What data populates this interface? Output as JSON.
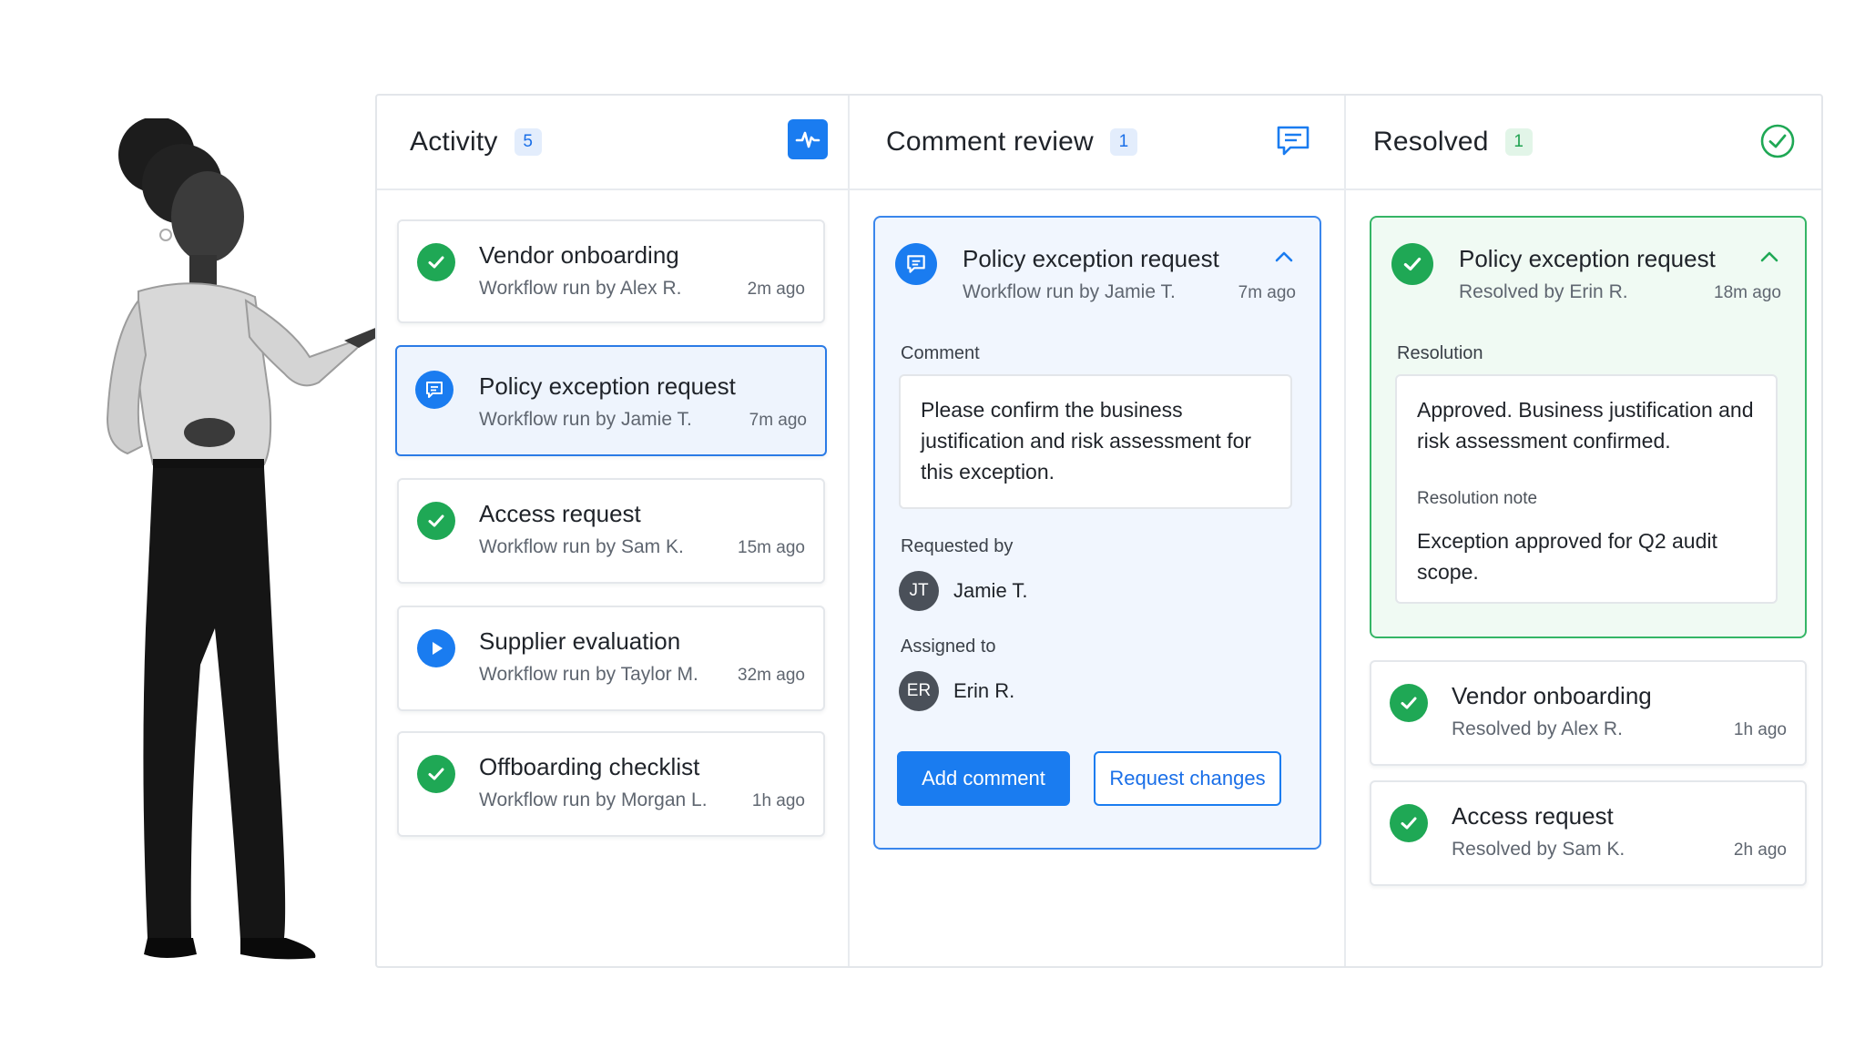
{
  "colors": {
    "accent": "#1a7cf0",
    "success": "#1fa855",
    "text": "#1f2329",
    "muted": "#5f6670"
  },
  "columns": {
    "activity": {
      "title": "Activity",
      "count": "5",
      "icon": "activity-pulse-icon",
      "items": [
        {
          "title": "Vendor onboarding",
          "sub": "Workflow run by Alex R.",
          "time": "2m ago",
          "status": "completed",
          "icon": "check-circle-icon"
        },
        {
          "title": "Policy exception request",
          "sub": "Workflow run by Jamie T.",
          "time": "7m ago",
          "status": "comment",
          "icon": "comment-icon"
        },
        {
          "title": "Access request",
          "sub": "Workflow run by Sam K.",
          "time": "15m ago",
          "status": "completed",
          "icon": "check-circle-icon"
        },
        {
          "title": "Supplier evaluation",
          "sub": "Workflow run by Taylor M.",
          "time": "32m ago",
          "status": "running",
          "icon": "play-icon"
        },
        {
          "title": "Offboarding checklist",
          "sub": "Workflow run by Morgan L.",
          "time": "1h ago",
          "status": "completed",
          "icon": "check-circle-icon"
        }
      ]
    },
    "review": {
      "title": "Comment review",
      "count": "1",
      "icon": "comment-icon",
      "card": {
        "title": "Policy exception request",
        "sub": "Workflow run by Jamie T.",
        "time": "7m ago",
        "comment_label": "Comment",
        "comment_text": "Please confirm the business justification and risk assessment for this exception.",
        "requested_by_label": "Requested by",
        "requester_initials": "JT",
        "requester_name": "Jamie T.",
        "assigned_to_label": "Assigned to",
        "assignee_initials": "ER",
        "assignee_name": "Erin R.",
        "add_comment_label": "Add comment",
        "request_changes_label": "Request changes"
      }
    },
    "resolved": {
      "title": "Resolved",
      "count": "1",
      "icon": "check-circle-outline-icon",
      "card": {
        "title": "Policy exception request",
        "sub": "Resolved by Erin R.",
        "time": "18m ago",
        "resolution_label": "Resolution",
        "resolution_text": "Approved. Business justification and risk assessment confirmed.",
        "note_label": "Resolution note",
        "note_text": "Exception approved for Q2 audit scope."
      },
      "items": [
        {
          "title": "Vendor onboarding",
          "sub": "Resolved by Alex R.",
          "time": "1h ago",
          "status": "completed",
          "icon": "check-circle-icon"
        },
        {
          "title": "Access request",
          "sub": "Resolved by Sam K.",
          "time": "2h ago",
          "status": "completed",
          "icon": "check-circle-icon"
        }
      ]
    }
  }
}
